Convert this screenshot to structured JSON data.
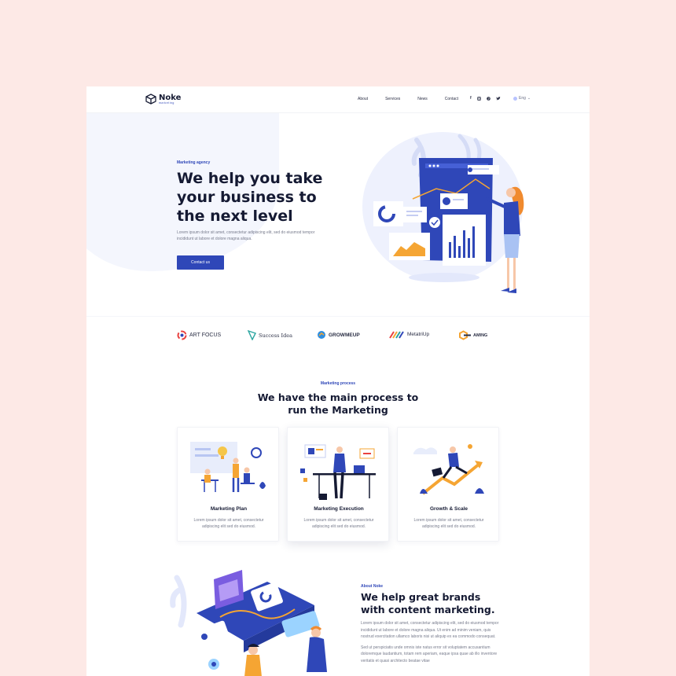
{
  "header": {
    "brand": "Noke",
    "brand_sub": "marketing",
    "nav": [
      "About",
      "Services",
      "News",
      "Contact"
    ],
    "social_icons": [
      "facebook-icon",
      "instagram-icon",
      "pinterest-icon",
      "twitter-icon"
    ],
    "language": "Eng"
  },
  "hero": {
    "eyebrow": "Marketing agency",
    "title": "We help you take your business to the next level",
    "text": "Lorem ipsum dolor sit amet, consectetur adipiscing elit, sed do eiusmod tempor incididunt ut labore et dolore magna aliqua.",
    "cta": "Contact us"
  },
  "partners": [
    {
      "name": "ART FOCUS",
      "icon": "art-focus-icon"
    },
    {
      "name": "Success Idea",
      "icon": "success-idea-icon"
    },
    {
      "name": "GROWMEUP",
      "icon": "growmeup-icon"
    },
    {
      "name": "MetatriUp",
      "icon": "metatriup-icon"
    },
    {
      "name": "AMING",
      "icon": "gaming-icon"
    }
  ],
  "process": {
    "eyebrow": "Marketing process",
    "title": "We have the main process to run the Marketing",
    "cards": [
      {
        "title": "Marketing Plan",
        "text": "Lorem ipsum dolor sit amet, consectetur adipiscing elit sed do eiusmod."
      },
      {
        "title": "Marketing Execution",
        "text": "Lorem ipsum dolor sit amet, consectetur adipiscing elit sed do eiusmod."
      },
      {
        "title": "Growth & Scale",
        "text": "Lorem ipsum dolor sit amet, consectetur adipiscing elit sed do eiusmod."
      }
    ]
  },
  "about": {
    "eyebrow": "About Noke",
    "title": "We help great brands with content marketing.",
    "text1": "Lorem ipsum dolor sit amet, consectetur adipiscing elit, sed do eiusmod tempor incididunt ut labore et dolore magna aliqua. Ut enim ad minim veniam, quis nostrud exercitation ullamco laboris nisi ut aliquip ex ea commodo consequat.",
    "text2": "Sed ut perspiciatis unde omnis iste natus error sit voluptatem accusantium doloremque laudantium, totam rem aperiam, eaque ipsa quae ab illo inventore veritatis et quasi architecto beatae vitae"
  },
  "colors": {
    "accent": "#2f47b8",
    "background": "#fde9e6",
    "heading": "#151a33",
    "body_text": "#777b8c"
  }
}
